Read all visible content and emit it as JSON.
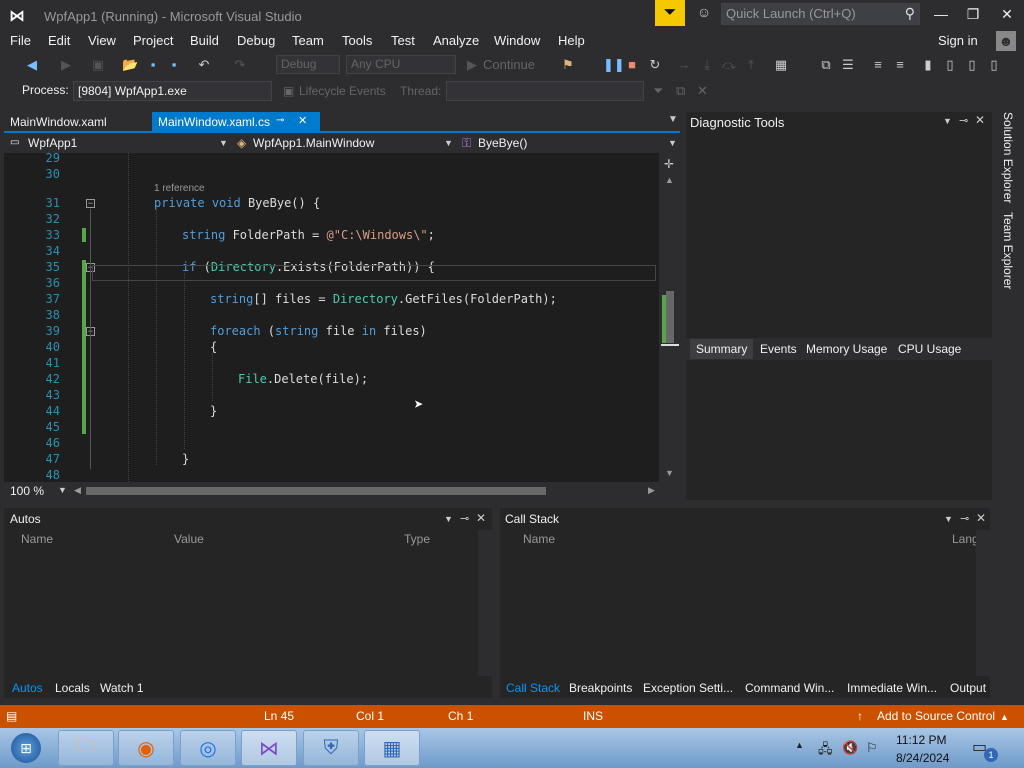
{
  "window": {
    "title": "WpfApp1 (Running) - Microsoft Visual Studio",
    "quick_launch_placeholder": "Quick Launch (Ctrl+Q)"
  },
  "menu": [
    "File",
    "Edit",
    "View",
    "Project",
    "Build",
    "Debug",
    "Team",
    "Tools",
    "Test",
    "Analyze",
    "Window",
    "Help"
  ],
  "account": {
    "signin": "Sign in"
  },
  "toolbar": {
    "config": "Debug",
    "platform": "Any CPU",
    "continue": "Continue"
  },
  "debug_location": {
    "process_label": "Process:",
    "process_value": "[9804] WpfApp1.exe",
    "lifecycle": "Lifecycle Events",
    "thread": "Thread:"
  },
  "tabs": [
    {
      "label": "MainWindow.xaml"
    },
    {
      "label": "MainWindow.xaml.cs"
    }
  ],
  "nav": {
    "project": "WpfApp1",
    "class": "WpfApp1.MainWindow",
    "member": "ByeBye()"
  },
  "editor": {
    "line_numbers": [
      "29",
      "30",
      "31",
      "32",
      "33",
      "34",
      "35",
      "36",
      "37",
      "38",
      "39",
      "40",
      "41",
      "42",
      "43",
      "44",
      "45",
      "46",
      "47",
      "48"
    ],
    "reference_label": "1 reference",
    "zoom": "100 %"
  },
  "diagnostic": {
    "title": "Diagnostic Tools",
    "tabs": [
      "Summary",
      "Events",
      "Memory Usage",
      "CPU Usage"
    ]
  },
  "side_tabs": [
    "Solution Explorer",
    "Team Explorer"
  ],
  "autos": {
    "title": "Autos",
    "columns": [
      "Name",
      "Value",
      "Type"
    ],
    "tabs": [
      "Autos",
      "Locals",
      "Watch 1"
    ]
  },
  "callstack": {
    "title": "Call Stack",
    "columns": [
      "Name",
      "Lang"
    ],
    "tabs": [
      "Call Stack",
      "Breakpoints",
      "Exception Setti...",
      "Command Win...",
      "Immediate Win...",
      "Output"
    ]
  },
  "status": {
    "line": "Ln 45",
    "col": "Col 1",
    "ch": "Ch 1",
    "mode": "INS",
    "source_control": "Add to Source Control"
  },
  "taskbar": {
    "time": "11:12 PM",
    "date": "8/24/2024",
    "notification_count": "1"
  },
  "colors": {
    "accent": "#007acc",
    "statusbar": "#ca5100",
    "filter": "#f5c800"
  }
}
